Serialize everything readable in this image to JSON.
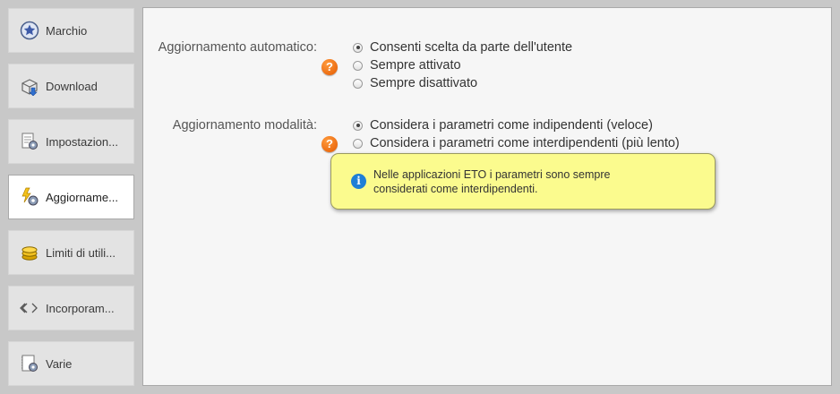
{
  "sidebar": {
    "items": [
      {
        "label": "Marchio",
        "icon": "star-badge-icon",
        "active": false
      },
      {
        "label": "Download",
        "icon": "download-box-icon",
        "active": false
      },
      {
        "label": "Impostazion...",
        "icon": "settings-page-icon",
        "active": false
      },
      {
        "label": "Aggiorname...",
        "icon": "update-gear-icon",
        "active": true
      },
      {
        "label": "Limiti di utili...",
        "icon": "coins-icon",
        "active": false
      },
      {
        "label": "Incorporam...",
        "icon": "embed-code-icon",
        "active": false
      },
      {
        "label": "Varie",
        "icon": "misc-settings-icon",
        "active": false
      }
    ]
  },
  "auto_update": {
    "label": "Aggiornamento automatico:",
    "options": [
      {
        "label": "Consenti scelta da parte dell'utente",
        "checked": true
      },
      {
        "label": "Sempre attivato",
        "checked": false
      },
      {
        "label": "Sempre disattivato",
        "checked": false
      }
    ]
  },
  "update_mode": {
    "label": "Aggiornamento modalità:",
    "options": [
      {
        "label": "Considera i parametri come indipendenti (veloce)",
        "checked": true
      },
      {
        "label": "Considera i parametri come interdipendenti (più lento)",
        "checked": false
      }
    ]
  },
  "help_glyph": "?",
  "tooltip": {
    "icon_glyph": "i",
    "text": "Nelle applicazioni ETO i parametri sono sempre considerati come interdipendenti."
  },
  "colors": {
    "help_orange": "#e45a00",
    "info_blue": "#1e7fd6",
    "tooltip_bg": "#fbfb8e"
  }
}
